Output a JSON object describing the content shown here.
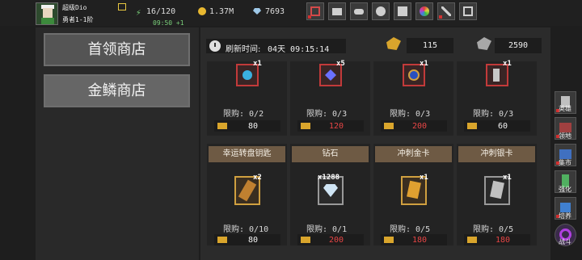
{
  "player": {
    "name": "超级Dio",
    "rank": "勇者1-1阶",
    "energy": "16/120",
    "timer": "09:50 +1",
    "gold": "1.37M",
    "gems": "7693"
  },
  "top_buttons": [
    {
      "icon": "shop-cart-icon"
    },
    {
      "icon": "mail-icon"
    },
    {
      "icon": "gamepad-icon"
    },
    {
      "icon": "gear-icon"
    },
    {
      "icon": "gift-icon"
    },
    {
      "icon": "color-wheel-icon"
    },
    {
      "icon": "crossed-swords-icon"
    },
    {
      "icon": "fullscreen-icon"
    }
  ],
  "shops": {
    "tab1": "首领商店",
    "tab2": "金鳞商店"
  },
  "refresh": {
    "label": "刷新时间:",
    "value": "04天 09:15:14"
  },
  "currencies": {
    "gold_scale": "115",
    "silver_scale": "2590"
  },
  "row1": [
    {
      "count": "x1",
      "limit": "限购: 0/2",
      "price": "80",
      "price_color": "#f2f2f2"
    },
    {
      "count": "x5",
      "limit": "限购: 0/3",
      "price": "120",
      "price_color": "#e64545"
    },
    {
      "count": "x1",
      "limit": "限购: 0/3",
      "price": "200",
      "price_color": "#e64545"
    },
    {
      "count": "x1",
      "limit": "限购: 0/3",
      "price": "60",
      "price_color": "#f2f2f2"
    }
  ],
  "row2": [
    {
      "name": "幸运转盘钥匙",
      "count": "x2",
      "limit": "限购: 0/10",
      "price": "80",
      "price_color": "#f2f2f2"
    },
    {
      "name": "钻石",
      "count": "x1288",
      "limit": "限购: 0/1",
      "price": "200",
      "price_color": "#e64545"
    },
    {
      "name": "冲刺金卡",
      "count": "x1",
      "limit": "限购: 0/5",
      "price": "180",
      "price_color": "#e64545"
    },
    {
      "name": "冲刺银卡",
      "count": "x1",
      "limit": "限购: 0/5",
      "price": "180",
      "price_color": "#e64545"
    }
  ],
  "right_menu": {
    "hero": "英雄",
    "territory": "领地",
    "market": "集市",
    "enhance": "强化",
    "cultivate": "培养",
    "battle": "战斗"
  }
}
